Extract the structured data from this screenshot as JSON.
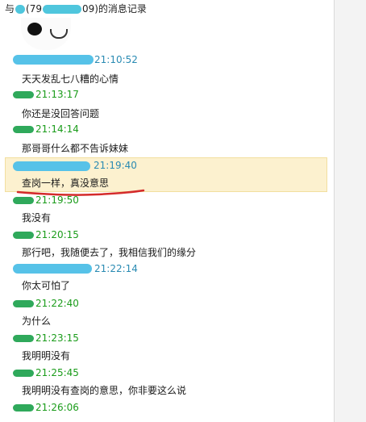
{
  "window": {
    "title_prefix": "与",
    "title_id_start": "(79",
    "title_id_end": "09)",
    "title_suffix": "的消息记录"
  },
  "messages": [
    {
      "time": "21:10:52",
      "text": "天天发乱七八糟的心情",
      "sender_color": "blue"
    },
    {
      "time": "21:13:17",
      "text": "你还是没回答问题",
      "sender_color": "green"
    },
    {
      "time": "21:14:14",
      "text": "那哥哥什么都不告诉妹妹",
      "sender_color": "green"
    },
    {
      "time": "21:19:40",
      "text": "查岗一样，真没意思",
      "sender_color": "blue"
    },
    {
      "time": "21:19:50",
      "text": "我没有",
      "sender_color": "green"
    },
    {
      "time": "21:20:15",
      "text": "那行吧，我随便去了，我相信我们的缘分",
      "sender_color": "green"
    },
    {
      "time": "21:22:14",
      "text": "你太可怕了",
      "sender_color": "blue"
    },
    {
      "time": "21:22:40",
      "text": "为什么",
      "sender_color": "green"
    },
    {
      "time": "21:23:15",
      "text": "我明明没有",
      "sender_color": "green"
    },
    {
      "time": "21:25:45",
      "text": "我明明没有查岗的意思，你非要这么说",
      "sender_color": "green"
    },
    {
      "time": "21:26:06",
      "text": "",
      "sender_color": "green"
    }
  ],
  "colors": {
    "highlight_bg": "#fcf1cf",
    "green_time": "#1b9c1b",
    "blue_time": "#2a8bb3",
    "underline": "#d42b2b"
  }
}
